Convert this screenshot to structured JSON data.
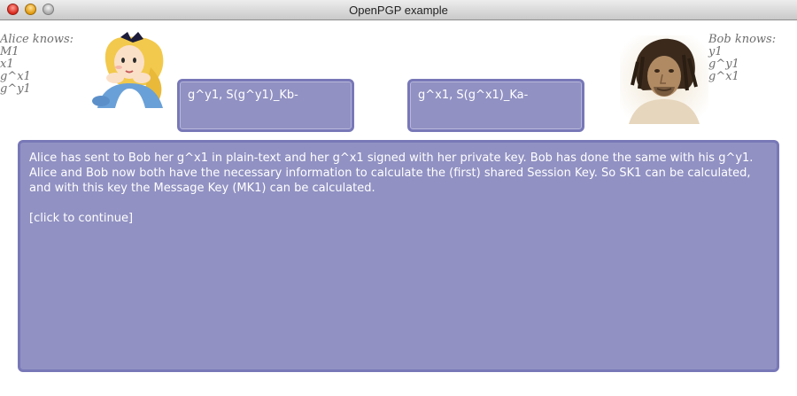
{
  "window": {
    "title": "OpenPGP example"
  },
  "alice": {
    "heading": "Alice knows:",
    "items": [
      "M1",
      "x1",
      "g^x1",
      "g^y1"
    ],
    "received": "g^y1, S(g^y1)_Kb-"
  },
  "bob": {
    "heading": "Bob knows:",
    "items": [
      "y1",
      "g^y1",
      "g^x1"
    ],
    "received": "g^x1, S(g^x1)_Ka-"
  },
  "explanation": {
    "text": "Alice has sent to Bob her g^x1 in plain-text and her g^x1 signed with her private key. Bob has done the same with his g^y1. Alice and Bob now both have the necessary information to calculate the (first) shared Session Key. So SK1 can be calculated, and with this key the Message Key (MK1) can be calculated.",
    "continue_label": "[click to continue]"
  },
  "colors": {
    "panel": "#9191c3",
    "panel_border": "#7878b8"
  }
}
